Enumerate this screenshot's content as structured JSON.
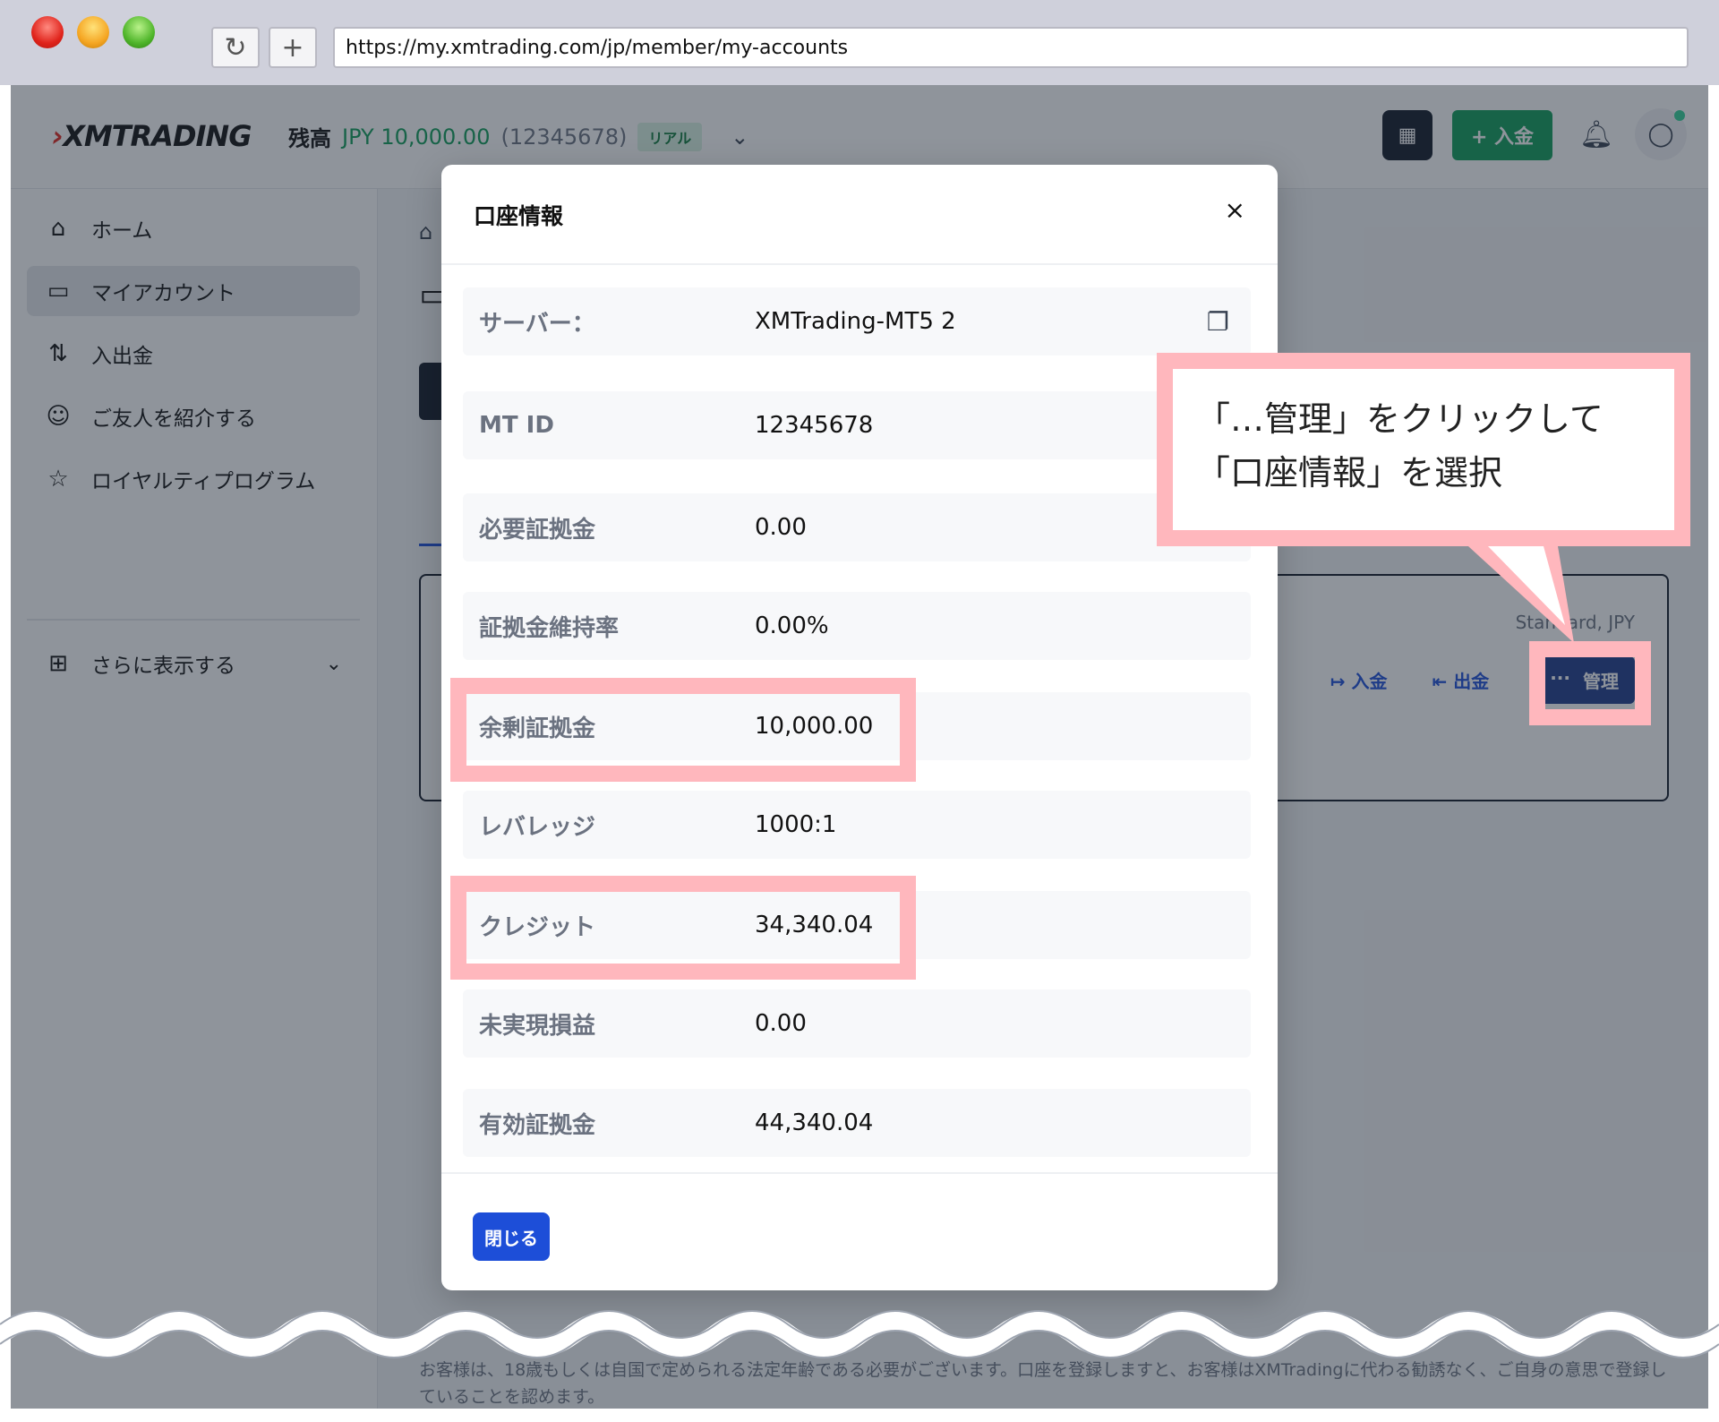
{
  "browser": {
    "url": "https://my.xmtrading.com/jp/member/my-accounts",
    "reload_icon": "reload-icon",
    "newtab_icon": "plus-icon"
  },
  "topbar": {
    "logo": "XMTRADING",
    "balance_label": "残高",
    "balance_amount": "JPY 10,000.00",
    "account_number": "(12345678)",
    "account_badge": "リアル",
    "deposit_label": "+ 入金"
  },
  "sidebar": {
    "items": [
      {
        "label": "ホーム",
        "icon": "home-icon"
      },
      {
        "label": "マイアカウント",
        "icon": "wallet-card-icon"
      },
      {
        "label": "入出金",
        "icon": "transfer-arrows-icon"
      },
      {
        "label": "ご友人を紹介する",
        "icon": "users-icon"
      },
      {
        "label": "ロイヤルティプログラム",
        "icon": "star-icon"
      }
    ],
    "more_label": "さらに表示する"
  },
  "card": {
    "meta": "Standard, JPY",
    "deposit": "入金",
    "withdraw": "出金",
    "manage": "管理"
  },
  "modal": {
    "title": "口座情報",
    "rows": [
      {
        "key": "サーバー：",
        "value": "XMTrading-MT5 2"
      },
      {
        "key": "MT ID",
        "value": "12345678"
      },
      {
        "key": "必要証拠金",
        "value": "0.00"
      },
      {
        "key": "証拠金維持率",
        "value": "0.00%"
      },
      {
        "key": "余剰証拠金",
        "value": "10,000.00"
      },
      {
        "key": "レバレッジ",
        "value": "1000:1"
      },
      {
        "key": "クレジット",
        "value": "34,340.04"
      },
      {
        "key": "未実現損益",
        "value": "0.00"
      },
      {
        "key": "有効証拠金",
        "value": "44,340.04"
      }
    ],
    "close_label": "閉じる"
  },
  "callout": {
    "line1": "「…管理」をクリックして",
    "line2": "「口座情報」を選択"
  },
  "footer_note": "お客様は、18歳もしくは自国で定められる法定年齢である必要がございます。口座を登録しますと、お客様はXMTradingに代わる勧誘なく、ご自身の意思で登録していることを認めます。",
  "colors": {
    "accent_green": "#0f9d58",
    "primary_blue": "#1d4ed8",
    "highlight_pink": "#ffb7bd"
  }
}
